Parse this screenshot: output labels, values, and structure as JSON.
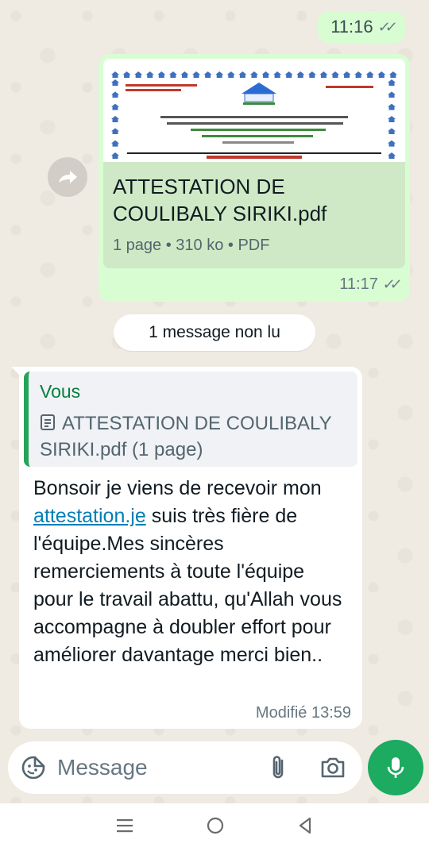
{
  "chat": {
    "outgoing_time": "11:16",
    "document": {
      "name": "ATTESTATION DE COULIBALY SIRIKI.pdf",
      "pages": "1 page",
      "size": "310 ko",
      "type": "PDF",
      "meta": "1 page • 310 ko • PDF",
      "time": "11:17"
    },
    "unread_label": "1 message non lu",
    "incoming": {
      "quote_author": "Vous",
      "quote_text": "ATTESTATION DE COULIBALY SIRIKI.pdf (1 page)",
      "body_before": "Bonsoir je viens de recevoir mon ",
      "link": "attestation.je",
      "body_after": " suis très fière de l'équipe.Mes sincères remerciements à toute l'équipe pour le travail abattu, qu'Allah vous accompagne à doubler effort pour améliorer davantage merci bien..",
      "time": "Modifié 13:59"
    }
  },
  "composer": {
    "placeholder": "Message"
  },
  "icons": {
    "ticks": "double-check-icon",
    "forward": "forward-icon",
    "doc": "document-icon",
    "emoji": "sticker-icon",
    "attach": "paperclip-icon",
    "camera": "camera-icon",
    "mic": "mic-icon"
  },
  "colors": {
    "outgoing_bubble": "#d9fdd3",
    "incoming_bubble": "#ffffff",
    "accent_green": "#1daa61",
    "quote_bar": "#25a35a",
    "link": "#027eb5"
  }
}
